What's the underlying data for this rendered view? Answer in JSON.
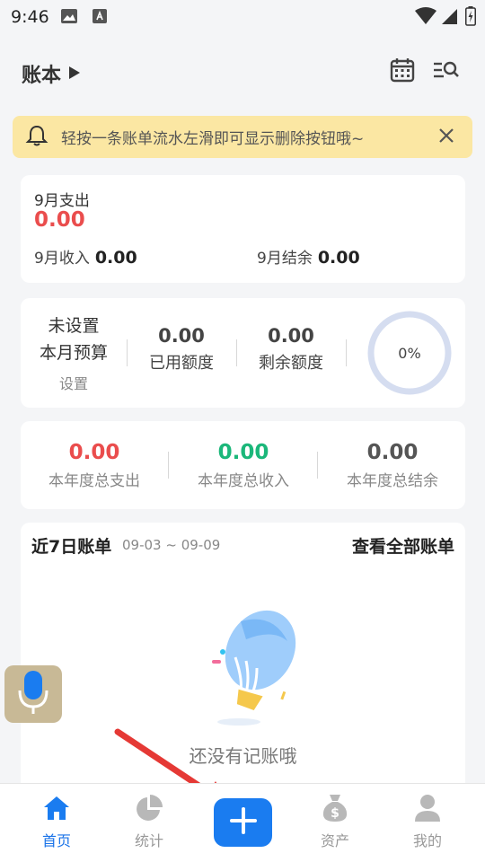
{
  "status_bar": {
    "time": "9:46"
  },
  "header": {
    "title": "账本"
  },
  "notice": {
    "text": "轻按一条账单流水左滑即可显示删除按钮哦~"
  },
  "month_summary": {
    "expense_label": "9月支出",
    "expense_value": "0.00",
    "income_label": "9月收入",
    "income_value": "0.00",
    "balance_label": "9月结余",
    "balance_value": "0.00"
  },
  "budget": {
    "status_line1": "未设置",
    "status_line2": "本月预算",
    "set_label": "设置",
    "used_value": "0.00",
    "used_label": "已用额度",
    "remaining_value": "0.00",
    "remaining_label": "剩余额度",
    "percent": "0%"
  },
  "yearly": [
    {
      "value": "0.00",
      "label": "本年度总支出",
      "color": "#ea4d4d"
    },
    {
      "value": "0.00",
      "label": "本年度总收入",
      "color": "#1bb77a"
    },
    {
      "value": "0.00",
      "label": "本年度总结余",
      "color": "#555555"
    }
  ],
  "recent": {
    "title": "近7日账单",
    "date_range": "09-03 ~ 09-09",
    "view_all": "查看全部账单",
    "empty_text": "还没有记账哦"
  },
  "tabs": [
    {
      "label": "首页",
      "icon": "home-icon",
      "active": true
    },
    {
      "label": "统计",
      "icon": "pie-chart-icon",
      "active": false
    },
    {
      "label": "资产",
      "icon": "money-bag-icon",
      "active": false
    },
    {
      "label": "我的",
      "icon": "user-icon",
      "active": false
    }
  ],
  "colors": {
    "accent": "#1a7cf0",
    "expense": "#ea4d4d",
    "income": "#1bb77a",
    "notice_bg": "#fbe7a3"
  }
}
